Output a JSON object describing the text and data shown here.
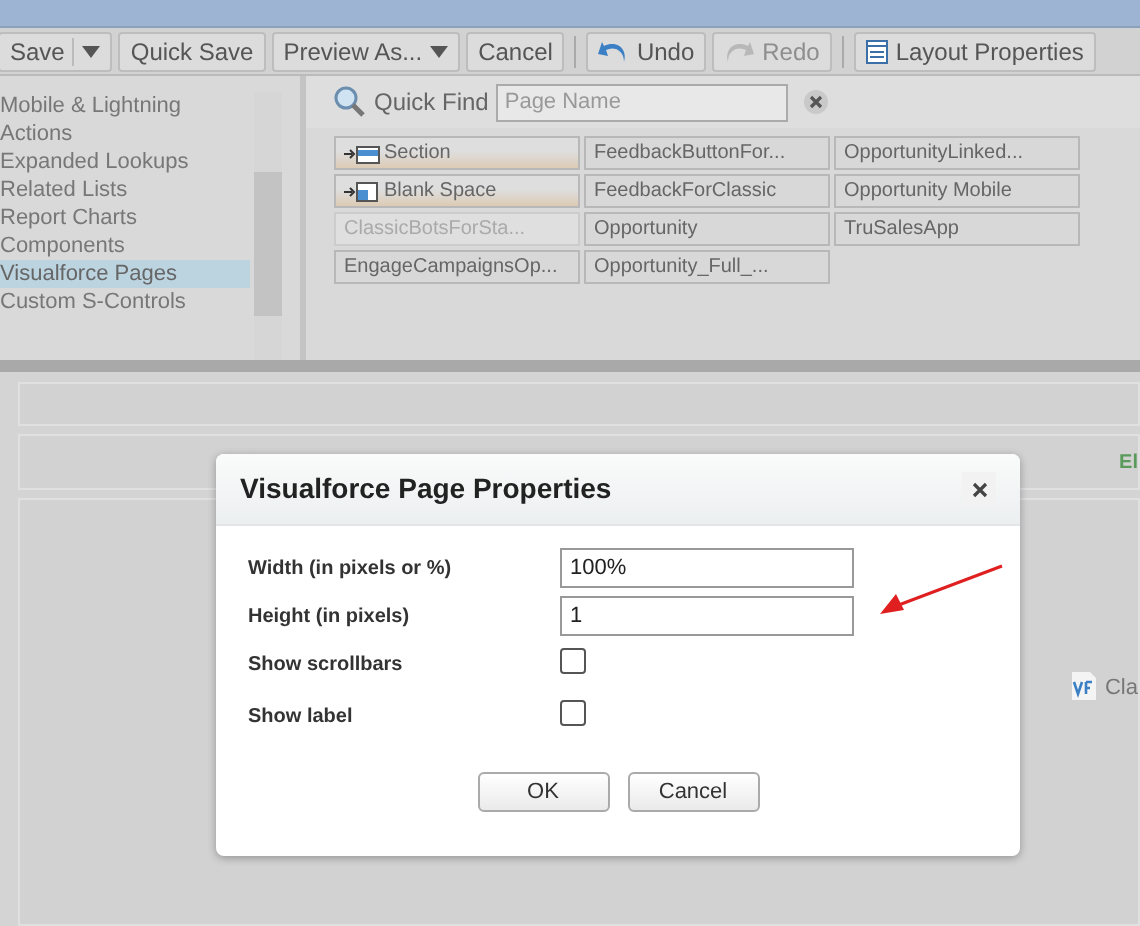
{
  "toolbar": {
    "buttons": [
      {
        "label": "Save",
        "kind": "split",
        "disabled": false
      },
      {
        "label": "Quick Save",
        "kind": "plain",
        "disabled": false
      },
      {
        "label": "Preview As...",
        "kind": "menu",
        "disabled": false
      },
      {
        "label": "Cancel",
        "kind": "plain",
        "disabled": false
      },
      {
        "kind": "separator"
      },
      {
        "label": "Undo",
        "kind": "undo",
        "disabled": false
      },
      {
        "label": "Redo",
        "kind": "redo",
        "disabled": true
      },
      {
        "kind": "separator"
      },
      {
        "label": "Layout Properties",
        "kind": "layout",
        "disabled": false
      }
    ]
  },
  "categories": [
    {
      "label": "Mobile & Lightning Actions",
      "selected": false
    },
    {
      "label": "Expanded Lookups",
      "selected": false
    },
    {
      "label": "Related Lists",
      "selected": false
    },
    {
      "label": "Report Charts",
      "selected": false
    },
    {
      "label": "Components",
      "selected": false
    },
    {
      "label": "Visualforce Pages",
      "selected": true
    },
    {
      "label": "Custom S-Controls",
      "selected": false
    }
  ],
  "quick_find": {
    "label": "Quick Find",
    "placeholder": "Page Name"
  },
  "palette": [
    {
      "label": "Section",
      "kind": "section",
      "disabled": false
    },
    {
      "label": "FeedbackButtonFor...",
      "kind": "page",
      "disabled": false
    },
    {
      "label": "OpportunityLinked...",
      "kind": "page",
      "disabled": false
    },
    {
      "label": "Blank Space",
      "kind": "blank",
      "disabled": false
    },
    {
      "label": "FeedbackForClassic",
      "kind": "page",
      "disabled": false
    },
    {
      "label": "Opportunity Mobile",
      "kind": "page",
      "disabled": false
    },
    {
      "label": "ClassicBotsForSta...",
      "kind": "page",
      "disabled": true
    },
    {
      "label": "Opportunity",
      "kind": "page",
      "disabled": false
    },
    {
      "label": "TruSalesApp",
      "kind": "page",
      "disabled": false
    },
    {
      "label": "EngageCampaignsOp...",
      "kind": "page",
      "disabled": false
    },
    {
      "label": "Opportunity_Full_...",
      "kind": "page",
      "disabled": false
    }
  ],
  "canvas": {
    "edge_text": "El",
    "vf_label": "Cla"
  },
  "dialog": {
    "title": "Visualforce Page Properties",
    "fields": [
      {
        "label": "Width (in pixels or %)",
        "kind": "text",
        "value": "100%"
      },
      {
        "label": "Height (in pixels)",
        "kind": "text",
        "value": "1"
      },
      {
        "label": "Show scrollbars",
        "kind": "checkbox",
        "checked": false
      },
      {
        "label": "Show label",
        "kind": "checkbox",
        "checked": false
      }
    ],
    "buttons": [
      "OK",
      "Cancel"
    ]
  }
}
